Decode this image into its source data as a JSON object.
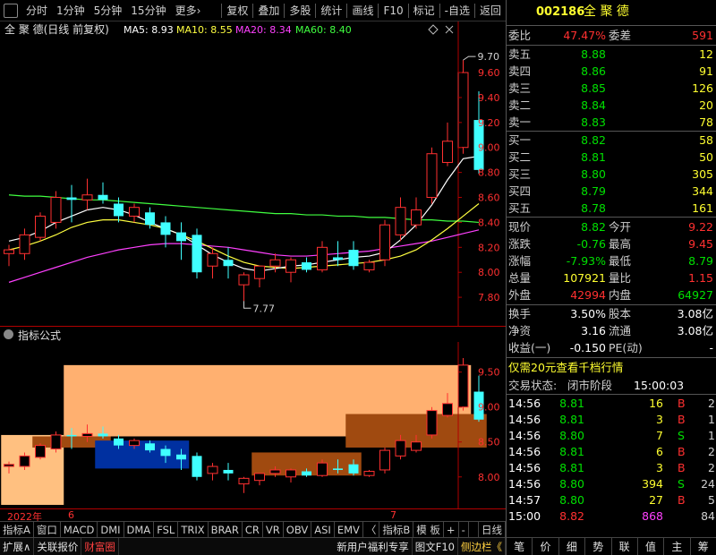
{
  "toolbar": {
    "left": [
      "分时",
      "1分钟",
      "5分钟",
      "15分钟",
      "更多›"
    ],
    "right": [
      "复权",
      "叠加",
      "多股",
      "统计",
      "画线",
      "F10",
      "标记",
      "-自选",
      "返回"
    ]
  },
  "main_header": {
    "name": "全 聚 德(日线 前复权)",
    "ma": [
      {
        "label": "MA5: 8.93",
        "color": "#ffffff"
      },
      {
        "label": "MA10: 8.55",
        "color": "#ffff40"
      },
      {
        "label": "MA20: 8.34",
        "color": "#ff40ff"
      },
      {
        "label": "MA60: 8.40",
        "color": "#40ff40"
      }
    ]
  },
  "indicator_header": {
    "label": "指标公式"
  },
  "chart_data": [
    {
      "type": "candlestick",
      "ylim": [
        7.6,
        9.88
      ],
      "yticks": [
        7.8,
        8.0,
        8.2,
        8.4,
        8.6,
        8.8,
        9.0,
        9.2,
        9.4,
        9.6
      ],
      "high_label": "9.70",
      "low_label": "7.77",
      "ohlc": [
        [
          8.15,
          8.22,
          8.05,
          8.18
        ],
        [
          8.15,
          8.35,
          8.1,
          8.3
        ],
        [
          8.28,
          8.48,
          8.25,
          8.45
        ],
        [
          8.4,
          8.65,
          8.35,
          8.6
        ],
        [
          8.6,
          8.7,
          8.4,
          8.58
        ],
        [
          8.58,
          8.75,
          8.5,
          8.62
        ],
        [
          8.62,
          8.72,
          8.55,
          8.58
        ],
        [
          8.55,
          8.6,
          8.4,
          8.45
        ],
        [
          8.45,
          8.55,
          8.4,
          8.52
        ],
        [
          8.48,
          8.52,
          8.35,
          8.38
        ],
        [
          8.4,
          8.45,
          8.2,
          8.3
        ],
        [
          8.32,
          8.4,
          8.1,
          8.25
        ],
        [
          8.3,
          8.35,
          7.95,
          8.0
        ],
        [
          8.05,
          8.2,
          7.95,
          8.15
        ],
        [
          8.1,
          8.2,
          7.95,
          8.05
        ],
        [
          7.9,
          8.0,
          7.77,
          7.98
        ],
        [
          7.95,
          8.05,
          7.88,
          8.05
        ],
        [
          8.05,
          8.15,
          8.0,
          8.1
        ],
        [
          8.0,
          8.12,
          7.92,
          8.1
        ],
        [
          8.08,
          8.12,
          8.0,
          8.02
        ],
        [
          8.02,
          8.25,
          8.0,
          8.2
        ],
        [
          8.12,
          8.25,
          8.05,
          8.1
        ],
        [
          8.18,
          8.25,
          8.02,
          8.05
        ],
        [
          8.02,
          8.1,
          8.0,
          8.08
        ],
        [
          8.1,
          8.42,
          8.05,
          8.38
        ],
        [
          8.3,
          8.6,
          8.25,
          8.52
        ],
        [
          8.38,
          8.6,
          8.35,
          8.5
        ],
        [
          8.6,
          9.0,
          8.55,
          8.95
        ],
        [
          8.88,
          9.2,
          8.85,
          9.05
        ],
        [
          9.0,
          9.7,
          8.95,
          9.6
        ],
        [
          9.22,
          9.45,
          8.79,
          8.82
        ]
      ],
      "ma5": [
        8.25,
        8.28,
        8.33,
        8.4,
        8.45,
        8.5,
        8.52,
        8.5,
        8.46,
        8.4,
        8.35,
        8.3,
        8.22,
        8.14,
        8.08,
        8.03,
        8.01,
        8.03,
        8.05,
        8.06,
        8.08,
        8.1,
        8.12,
        8.13,
        8.16,
        8.26,
        8.38,
        8.54,
        8.74,
        8.91,
        8.93
      ],
      "ma10": [
        8.18,
        8.21,
        8.25,
        8.3,
        8.36,
        8.4,
        8.42,
        8.42,
        8.4,
        8.38,
        8.35,
        8.3,
        8.25,
        8.19,
        8.13,
        8.08,
        8.05,
        8.04,
        8.03,
        8.04,
        8.05,
        8.06,
        8.07,
        8.08,
        8.1,
        8.13,
        8.18,
        8.26,
        8.35,
        8.45,
        8.55
      ],
      "ma20": [
        7.92,
        7.96,
        8.0,
        8.04,
        8.08,
        8.12,
        8.15,
        8.18,
        8.2,
        8.22,
        8.23,
        8.23,
        8.22,
        8.21,
        8.2,
        8.18,
        8.16,
        8.14,
        8.13,
        8.13,
        8.14,
        8.15,
        8.16,
        8.17,
        8.19,
        8.21,
        8.23,
        8.25,
        8.28,
        8.31,
        8.34
      ],
      "ma60": [
        8.62,
        8.61,
        8.61,
        8.6,
        8.59,
        8.58,
        8.58,
        8.57,
        8.56,
        8.55,
        8.54,
        8.53,
        8.52,
        8.51,
        8.5,
        8.49,
        8.48,
        8.47,
        8.47,
        8.46,
        8.46,
        8.45,
        8.45,
        8.44,
        8.44,
        8.43,
        8.42,
        8.42,
        8.41,
        8.41,
        8.4
      ]
    },
    {
      "type": "candlestick",
      "ylim": [
        7.6,
        9.88
      ],
      "yticks": [
        8.0,
        8.5,
        9.0,
        9.5
      ],
      "xticks": [
        "2022年",
        "6",
        "7"
      ],
      "boxes": [
        {
          "from": 0,
          "to": 3,
          "top": 8.6,
          "bottom": 7.6,
          "color": "#ffc080"
        },
        {
          "from": 4,
          "to": 29,
          "top": 9.6,
          "bottom": 8.58,
          "color": "#ffb070"
        },
        {
          "from": 2,
          "to": 6,
          "top": 8.58,
          "bottom": 8.42,
          "color": "#a04a10"
        },
        {
          "from": 6,
          "to": 11,
          "top": 8.52,
          "bottom": 8.12,
          "color": "#0030a0"
        },
        {
          "from": 16,
          "to": 22,
          "top": 8.35,
          "bottom": 8.02,
          "color": "#a04a10"
        },
        {
          "from": 22,
          "to": 30,
          "top": 8.9,
          "bottom": 8.42,
          "color": "#a04a10"
        }
      ]
    }
  ],
  "tabs": [
    "指标A",
    "窗口",
    "MACD",
    "DMI",
    "DMA",
    "FSL",
    "TRIX",
    "BRAR",
    "CR",
    "VR",
    "OBV",
    "ASI",
    "EMV",
    "〈",
    "指标B",
    "模 板",
    "+",
    "-",
    "日线"
  ],
  "bottombar": [
    {
      "label": "扩展∧",
      "color": "#e0e0e0"
    },
    {
      "label": "关联报价",
      "color": "#e0e0e0"
    },
    {
      "label": "财富圈",
      "color": "#ff4040"
    },
    {
      "label": "新用户福利专享",
      "color": "#e0e0e0"
    },
    {
      "label": "图文F10",
      "color": "#e0e0e0"
    },
    {
      "label": "侧边栏《",
      "color": "#ffd040"
    }
  ],
  "panel": {
    "code": "002186",
    "name": "全 聚 德",
    "weibi": {
      "label": "委比",
      "value": "47.47%",
      "label2": "委差",
      "value2": "591"
    },
    "asks": [
      {
        "label": "卖五",
        "price": "8.88",
        "vol": "12"
      },
      {
        "label": "卖四",
        "price": "8.86",
        "vol": "91"
      },
      {
        "label": "卖三",
        "price": "8.85",
        "vol": "126"
      },
      {
        "label": "卖二",
        "price": "8.84",
        "vol": "20"
      },
      {
        "label": "卖一",
        "price": "8.83",
        "vol": "78"
      }
    ],
    "bids": [
      {
        "label": "买一",
        "price": "8.82",
        "vol": "58"
      },
      {
        "label": "买二",
        "price": "8.81",
        "vol": "50"
      },
      {
        "label": "买三",
        "price": "8.80",
        "vol": "305"
      },
      {
        "label": "买四",
        "price": "8.79",
        "vol": "344"
      },
      {
        "label": "买五",
        "price": "8.78",
        "vol": "161"
      }
    ],
    "quote": [
      {
        "l1": "现价",
        "v1": "8.82",
        "c1": "#00e000",
        "l2": "今开",
        "v2": "9.22",
        "c2": "#ff3030"
      },
      {
        "l1": "涨跌",
        "v1": "-0.76",
        "c1": "#00e000",
        "l2": "最高",
        "v2": "9.45",
        "c2": "#ff3030"
      },
      {
        "l1": "涨幅",
        "v1": "-7.93%",
        "c1": "#00e000",
        "l2": "最低",
        "v2": "8.79",
        "c2": "#00e000"
      },
      {
        "l1": "总量",
        "v1": "107921",
        "c1": "#ffff30",
        "l2": "量比",
        "v2": "1.15",
        "c2": "#ff3030"
      },
      {
        "l1": "外盘",
        "v1": "42994",
        "c1": "#ff3030",
        "l2": "内盘",
        "v2": "64927",
        "c2": "#00e000"
      }
    ],
    "fund": [
      {
        "l1": "换手",
        "v1": "3.50%",
        "l2": "股本",
        "v2": "3.08亿"
      },
      {
        "l1": "净资",
        "v1": "3.16",
        "l2": "流通",
        "v2": "3.08亿"
      },
      {
        "l1": "收益(一)",
        "v1": "-0.150",
        "l2": "PE(动)",
        "v2": "-"
      }
    ],
    "promo": "仅需20元查看千档行情",
    "status": {
      "label": "交易状态:",
      "value": "闭市阶段",
      "time": "15:00:03"
    },
    "ticks": [
      {
        "t": "14:56",
        "p": "8.81",
        "v": "16",
        "bs": "B",
        "n": "2"
      },
      {
        "t": "14:56",
        "p": "8.81",
        "v": "3",
        "bs": "B",
        "n": "1"
      },
      {
        "t": "14:56",
        "p": "8.80",
        "v": "7",
        "bs": "S",
        "n": "1"
      },
      {
        "t": "14:56",
        "p": "8.81",
        "v": "6",
        "bs": "B",
        "n": "2"
      },
      {
        "t": "14:56",
        "p": "8.81",
        "v": "3",
        "bs": "B",
        "n": "2"
      },
      {
        "t": "14:56",
        "p": "8.80",
        "v": "394",
        "bs": "S",
        "n": "24"
      },
      {
        "t": "14:57",
        "p": "8.80",
        "v": "27",
        "bs": "B",
        "n": "5"
      },
      {
        "t": "15:00",
        "p": "8.82",
        "v": "868",
        "bs": "",
        "n": "84"
      }
    ],
    "bottom_tabs": [
      "笔",
      "价",
      "细",
      "势",
      "联",
      "值",
      "主",
      "筹"
    ]
  },
  "colors": {
    "up": "#ff3030",
    "down": "#40ffff",
    "grid": "#7a0000",
    "axis": "#b00000",
    "ma5": "#ffffff",
    "ma10": "#ffff40",
    "ma20": "#ff40ff",
    "ma60": "#40ff40"
  }
}
